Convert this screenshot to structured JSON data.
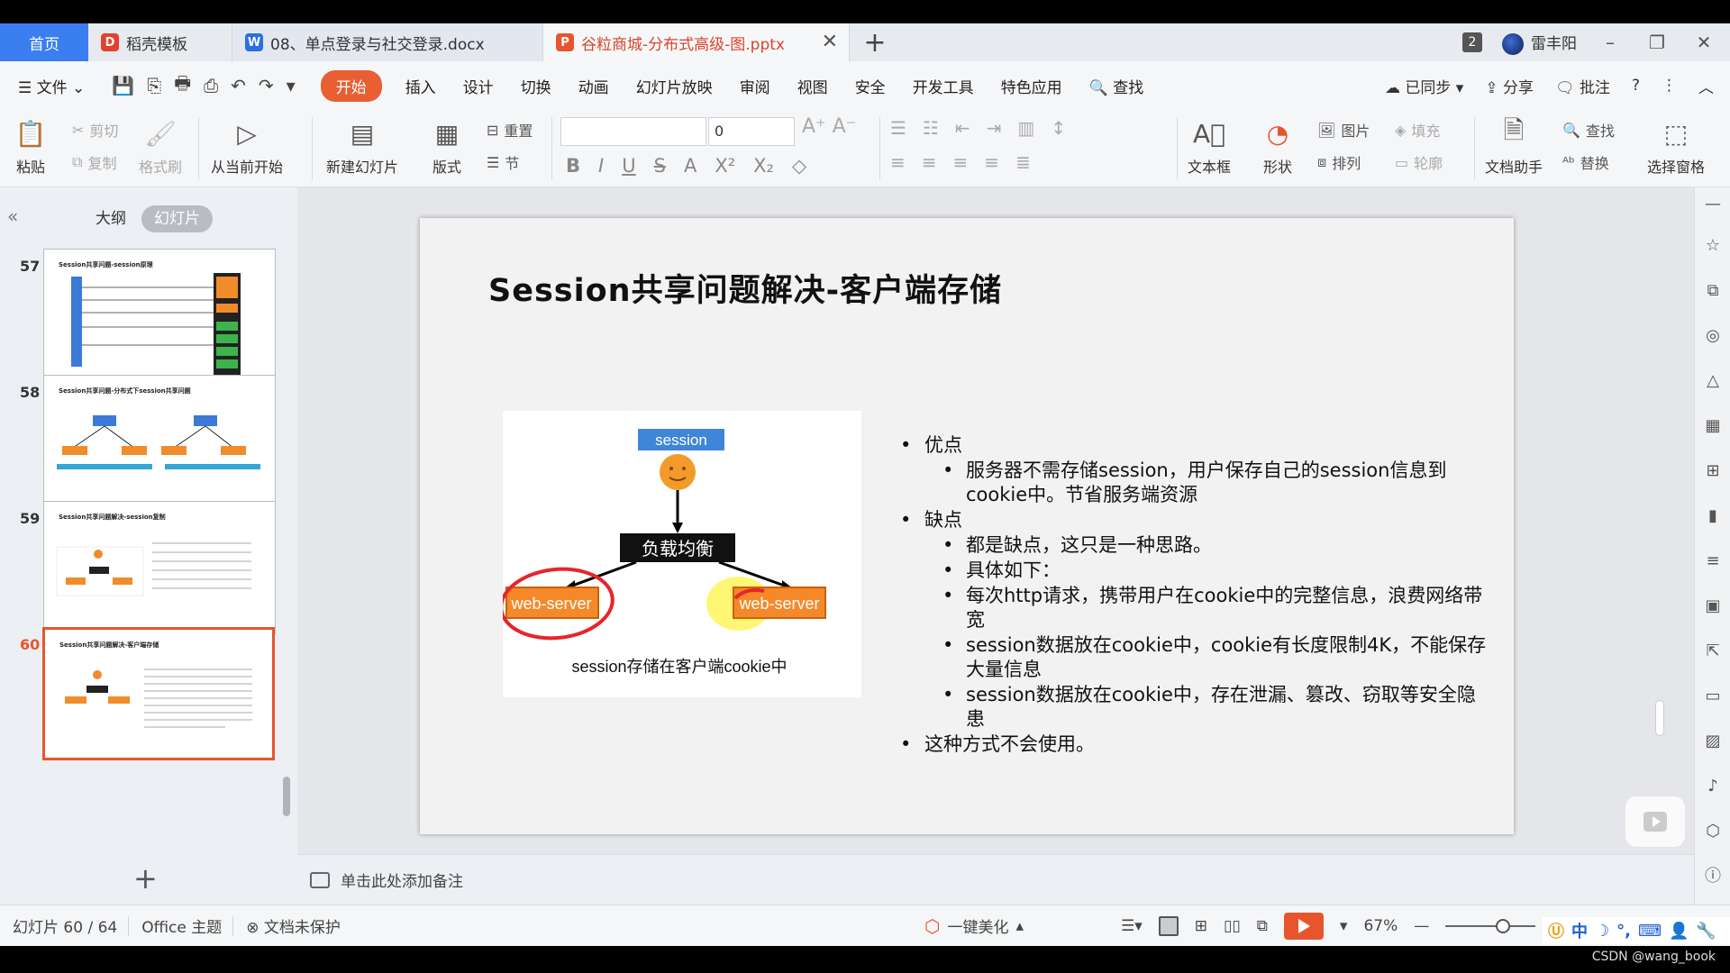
{
  "tabs": {
    "home": "首页",
    "items": [
      {
        "label": "稻壳模板",
        "icon": "docer-icon"
      },
      {
        "label": "08、单点登录与社交登录.docx",
        "icon": "word-icon"
      },
      {
        "label": "谷粒商城-分布式高级-图.pptx",
        "icon": "ppt-icon",
        "active": true
      }
    ],
    "add": "+",
    "badge": "2",
    "user": "雷丰阳"
  },
  "menu": {
    "file": "文件",
    "items": [
      "开始",
      "插入",
      "设计",
      "切换",
      "动画",
      "幻灯片放映",
      "审阅",
      "视图",
      "安全",
      "开发工具",
      "特色应用"
    ],
    "active": "开始",
    "search": "查找",
    "synced": "已同步",
    "share": "分享",
    "comment": "批注"
  },
  "ribbon": {
    "paste": "粘贴",
    "cut": "剪切",
    "copy": "复制",
    "format_painter": "格式刷",
    "play_from_current": "从当前开始",
    "new_slide": "新建幻灯片",
    "layout": "版式",
    "reset": "重置",
    "section": "节",
    "font_size": "0",
    "textbox": "文本框",
    "shape": "形状",
    "picture": "图片",
    "arrange": "排列",
    "fill": "填充",
    "outline": "轮廓",
    "doc_assistant": "文档助手",
    "find": "查找",
    "replace": "替换",
    "select_pane": "选择窗格"
  },
  "left_pane": {
    "tab_outline": "大纲",
    "tab_slides": "幻灯片",
    "thumbnails": [
      {
        "num": "57",
        "title": "Session共享问题-session原理"
      },
      {
        "num": "58",
        "title": "Session共享问题-分布式下session共享问题"
      },
      {
        "num": "59",
        "title": "Session共享问题解决-session复制"
      },
      {
        "num": "60",
        "title": "Session共享问题解决-客户端存储",
        "current": true
      }
    ]
  },
  "slide": {
    "title": "Session共享问题解决-客户端存储",
    "diagram": {
      "top_label": "session",
      "balancer": "负载均衡",
      "left_server": "web-server",
      "right_server": "web-server",
      "caption": "session存储在客户端cookie中"
    },
    "bullets": [
      {
        "level": 1,
        "text": "优点"
      },
      {
        "level": 2,
        "text": "服务器不需存储session，用户保存自己的session信息到cookie中。节省服务端资源"
      },
      {
        "level": 1,
        "text": "缺点"
      },
      {
        "level": 2,
        "text": "都是缺点，这只是一种思路。"
      },
      {
        "level": 2,
        "text": "具体如下："
      },
      {
        "level": 2,
        "text": "每次http请求，携带用户在cookie中的完整信息，浪费网络带宽"
      },
      {
        "level": 2,
        "text": "session数据放在cookie中，cookie有长度限制4K，不能保存大量信息"
      },
      {
        "level": 2,
        "text": "session数据放在cookie中，存在泄漏、篡改、窃取等安全隐患"
      },
      {
        "level": 1,
        "text": "这种方式不会使用。"
      }
    ]
  },
  "notes_placeholder": "单击此处添加备注",
  "status": {
    "slide_counter": "幻灯片 60 / 64",
    "theme": "Office 主题",
    "protection": "文档未保护",
    "beautify": "一键美化",
    "zoom": "67%"
  },
  "ime": "中",
  "watermark": "CSDN @wang_book",
  "colors": {
    "accent": "#e8552c",
    "home_tab": "#3b7ef1"
  }
}
